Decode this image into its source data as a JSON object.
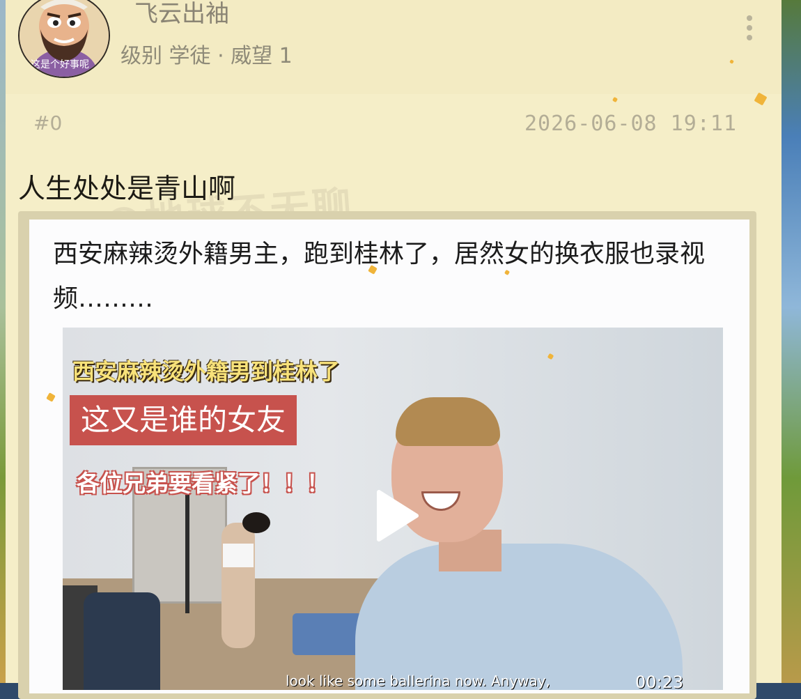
{
  "user": {
    "name": "飞云出袖",
    "level_text": "级别 学徒 · 威望 1",
    "avatar_caption": "这是个好事呢"
  },
  "post": {
    "floor": "#0",
    "timestamp": "2026-06-08 19:11",
    "text": "人生处处是青山啊",
    "watermark": "@地球不无聊"
  },
  "quote": {
    "text": "西安麻辣烫外籍男主，跑到桂林了，居然女的换衣服也录视频………"
  },
  "video": {
    "caption_top": "西安麻辣烫外籍男到桂林了",
    "caption_banner": "这又是谁的女友",
    "caption_warning": "各位兄弟要看紧了！！！",
    "subtitle": "look like some ballerina now. Anyway,",
    "duration": "00:23"
  },
  "colors": {
    "card_bg": "#f5eec8",
    "caption_red": "#c7524d",
    "caption_yellow": "#f8e27a"
  }
}
